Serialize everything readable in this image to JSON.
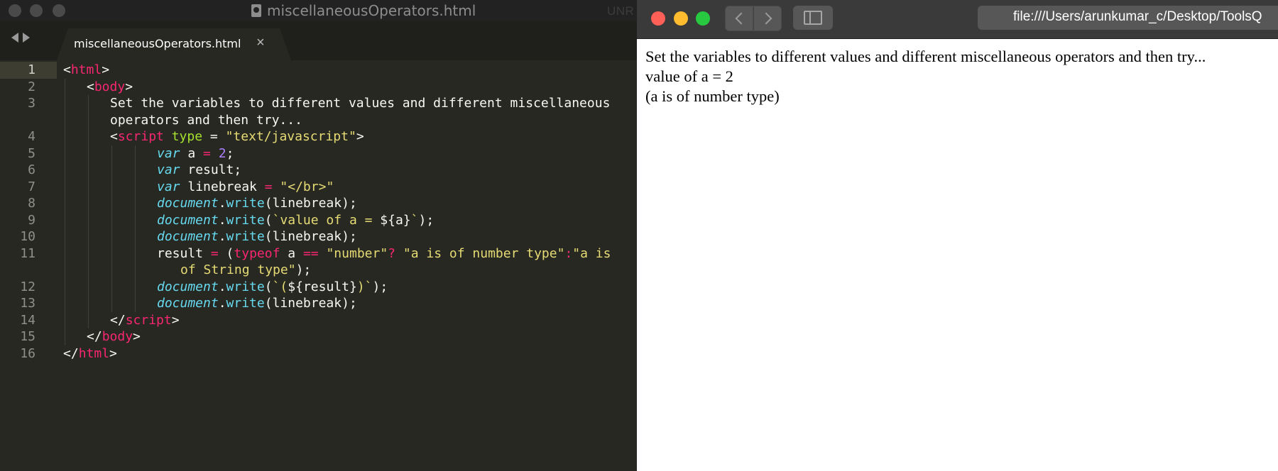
{
  "editor": {
    "window_title": "miscellaneousOperators.html",
    "unregistered_label": "UNR",
    "tab_label": "miscellaneousOperators.html",
    "tab_close": "×",
    "line_numbers": [
      "1",
      "2",
      "3",
      "",
      "4",
      "5",
      "6",
      "7",
      "8",
      "9",
      "10",
      "11",
      "",
      "12",
      "13",
      "14",
      "15",
      "16"
    ]
  },
  "browser": {
    "url": "file:///Users/arunkumar_c/Desktop/ToolsQ",
    "output_lines": [
      "Set the variables to different values and different miscellaneous operators and then try...",
      "value of a = 2",
      "(a is of number type)"
    ]
  },
  "colors": {
    "editor_bg": "#272822",
    "keyword": "#f92672",
    "attribute": "#a6e22e",
    "string": "#e6db74",
    "storage": "#66d9ef",
    "number": "#ae81ff",
    "traffic_red": "#fe5f57",
    "traffic_yellow": "#febc2e",
    "traffic_green": "#28c840"
  },
  "icons": [
    "document-icon",
    "back-arrow-icon",
    "forward-arrow-icon",
    "close-icon",
    "sidebar-icon",
    "chevron-left-icon",
    "chevron-right-icon"
  ]
}
